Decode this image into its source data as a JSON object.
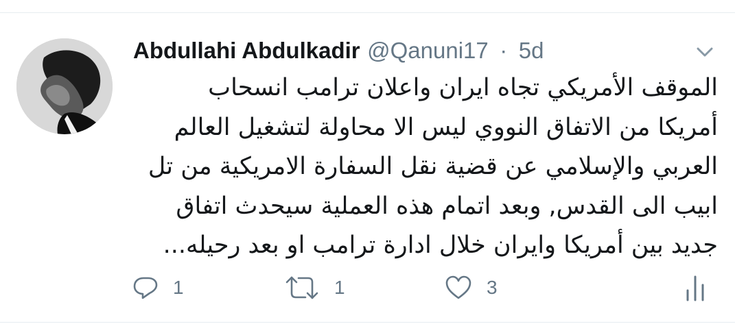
{
  "tweet": {
    "author_name": "Abdullahi Abdulkadir",
    "author_handle": "@Qanuni17",
    "separator": "·",
    "time": "5d",
    "lines": [
      "الموقف الأمريكي تجاه ايران واعلان ترامب انسحاب",
      "أمريكا من الاتفاق النووي ليس الا محاولة لتشغيل العالم",
      "العربي والإسلامي عن قضية نقل السفارة الامريكية من تل",
      "ابيب الى القدس,  وبعد اتمام هذه العملية سيحدث اتفاق",
      "جديد بين أمريكا وايران خلال ادارة ترامب او بعد رحيله..."
    ]
  },
  "actions": {
    "reply_count": "1",
    "retweet_count": "1",
    "like_count": "3"
  },
  "icons": {
    "reply": "reply-icon",
    "retweet": "retweet-icon",
    "like": "heart-icon",
    "stats": "analytics-icon",
    "caret": "chevron-down-icon"
  },
  "colors": {
    "text_primary": "#14171a",
    "text_secondary": "#657786",
    "divider": "#e6ecf0"
  }
}
